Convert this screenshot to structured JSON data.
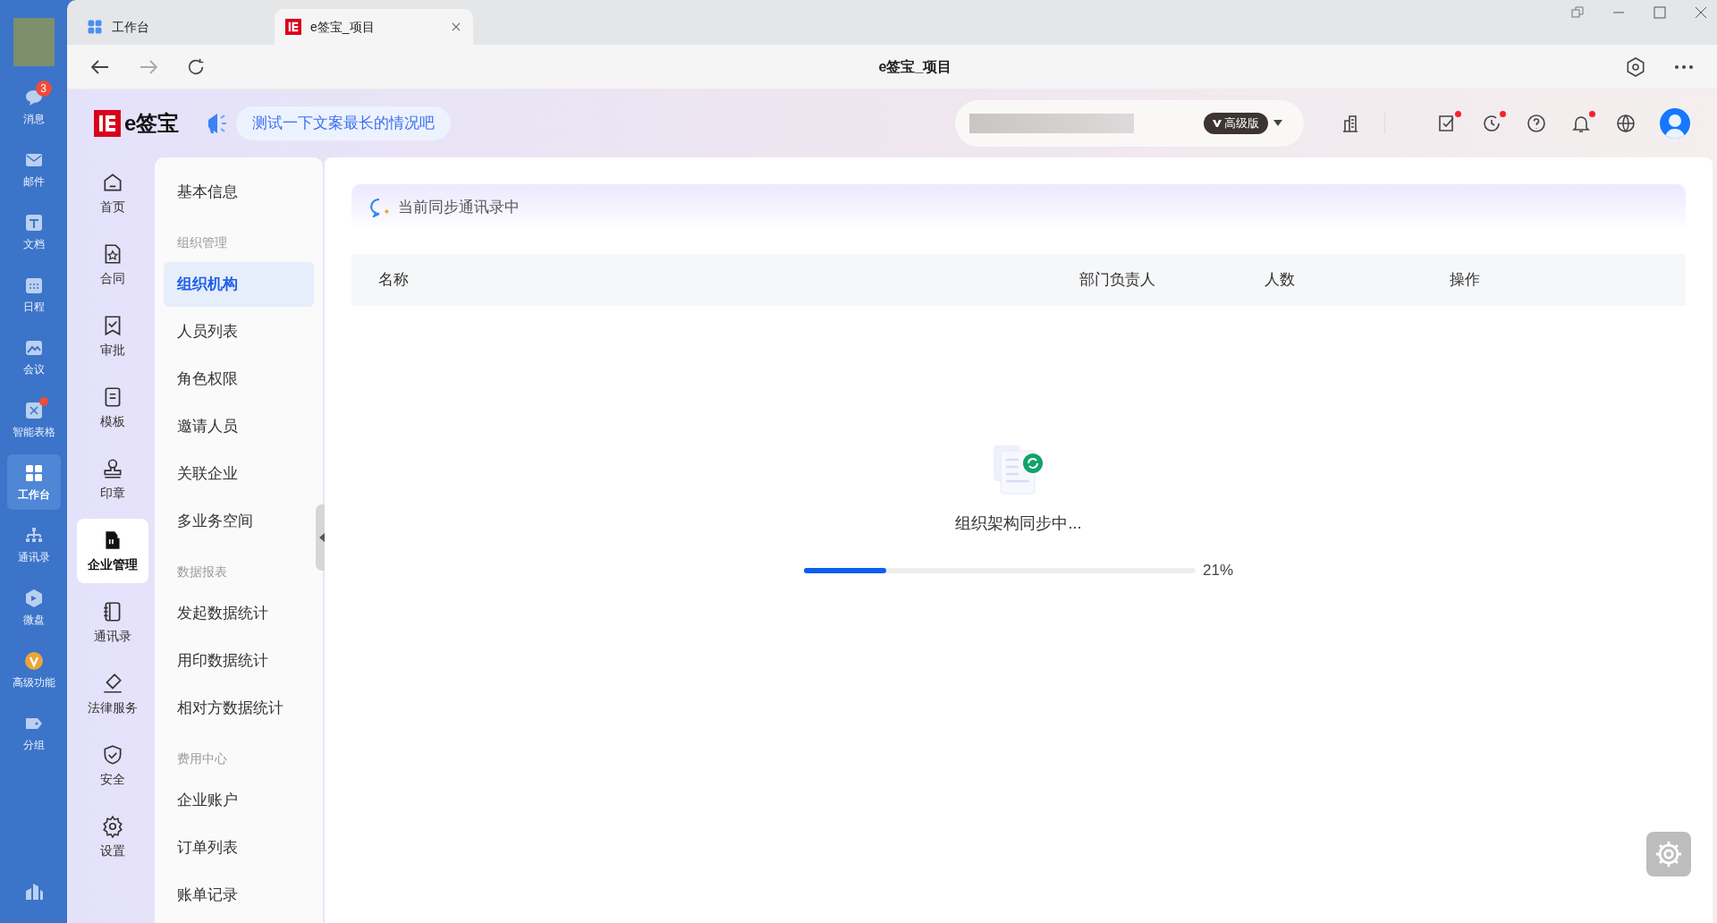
{
  "browser": {
    "tabs": [
      {
        "label": "工作台",
        "selected": false
      },
      {
        "label": "e签宝_项目",
        "selected": true
      }
    ],
    "title": "e签宝_项目"
  },
  "rail": {
    "items": [
      {
        "label": "消息",
        "selected": false,
        "badge": "3",
        "dot": false
      },
      {
        "label": "邮件",
        "selected": false,
        "dot": false
      },
      {
        "label": "文档",
        "selected": false,
        "dot": false
      },
      {
        "label": "日程",
        "selected": false,
        "dot": false
      },
      {
        "label": "会议",
        "selected": false,
        "dot": false
      },
      {
        "label": "智能表格",
        "selected": false,
        "dot": true
      },
      {
        "label": "工作台",
        "selected": true,
        "dot": false
      },
      {
        "label": "通讯录",
        "selected": false,
        "dot": false
      },
      {
        "label": "微盘",
        "selected": false,
        "dot": false
      },
      {
        "label": "高级功能",
        "selected": false,
        "dot": false
      },
      {
        "label": "分组",
        "selected": false,
        "dot": false
      }
    ]
  },
  "header": {
    "logo": "e签宝",
    "announcement": "测试一下文案最长的情况吧",
    "plan": "高级版",
    "icons": [
      {
        "dot": false
      },
      {
        "dot": true
      },
      {
        "dot": true
      },
      {
        "dot": false
      },
      {
        "dot": true
      },
      {
        "dot": false
      }
    ]
  },
  "app_nav": [
    {
      "label": "首页",
      "selected": false
    },
    {
      "label": "合同",
      "selected": false
    },
    {
      "label": "审批",
      "selected": false
    },
    {
      "label": "模板",
      "selected": false
    },
    {
      "label": "印章",
      "selected": false
    },
    {
      "label": "企业管理",
      "selected": true
    },
    {
      "label": "通讯录",
      "selected": false
    },
    {
      "label": "法律服务",
      "selected": false
    },
    {
      "label": "安全",
      "selected": false
    },
    {
      "label": "设置",
      "selected": false
    }
  ],
  "menu": [
    {
      "kind": "item",
      "label": "基本信息",
      "selected": false
    },
    {
      "kind": "heading",
      "label": "组织管理"
    },
    {
      "kind": "item",
      "label": "组织机构",
      "selected": true
    },
    {
      "kind": "item",
      "label": "人员列表",
      "selected": false
    },
    {
      "kind": "item",
      "label": "角色权限",
      "selected": false
    },
    {
      "kind": "item",
      "label": "邀请人员",
      "selected": false
    },
    {
      "kind": "item",
      "label": "关联企业",
      "selected": false
    },
    {
      "kind": "item",
      "label": "多业务空间",
      "selected": false
    },
    {
      "kind": "heading",
      "label": "数据报表"
    },
    {
      "kind": "item",
      "label": "发起数据统计",
      "selected": false
    },
    {
      "kind": "item",
      "label": "用印数据统计",
      "selected": false
    },
    {
      "kind": "item",
      "label": "相对方数据统计",
      "selected": false
    },
    {
      "kind": "heading",
      "label": "费用中心"
    },
    {
      "kind": "item",
      "label": "企业账户",
      "selected": false
    },
    {
      "kind": "item",
      "label": "订单列表",
      "selected": false
    },
    {
      "kind": "item",
      "label": "账单记录",
      "selected": false
    }
  ],
  "content": {
    "banner": "当前同步通讯录中",
    "table": {
      "columns": [
        "名称",
        "部门负责人",
        "人数",
        "操作"
      ]
    },
    "loading": {
      "text": "组织架构同步中...",
      "level": 0.21,
      "reading": "21%"
    }
  }
}
